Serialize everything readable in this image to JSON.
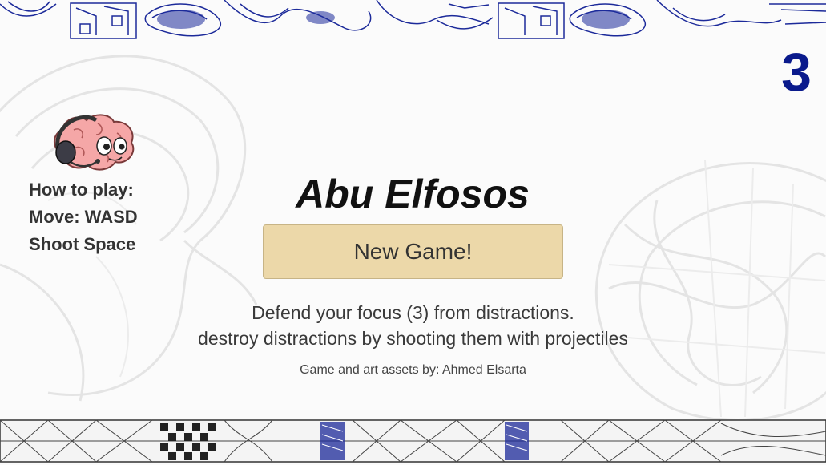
{
  "hud": {
    "focus_count": "3"
  },
  "instructions": {
    "line1": "How to play:",
    "line2": "Move: WASD",
    "line3": "Shoot Space"
  },
  "menu": {
    "title": "Abu Elfosos",
    "new_game_label": "New Game!",
    "description_line1": "Defend your focus (3) from distractions.",
    "description_line2": "destroy distractions by shooting them with projectiles",
    "credits": "Game and art assets by: Ahmed Elsarta"
  },
  "icons": {
    "mascot": "brain-with-headset-icon"
  },
  "colors": {
    "focus_counter": "#0a1a8c",
    "button_fill": "#ecd8a9",
    "border_ink": "#1c2a9a"
  }
}
